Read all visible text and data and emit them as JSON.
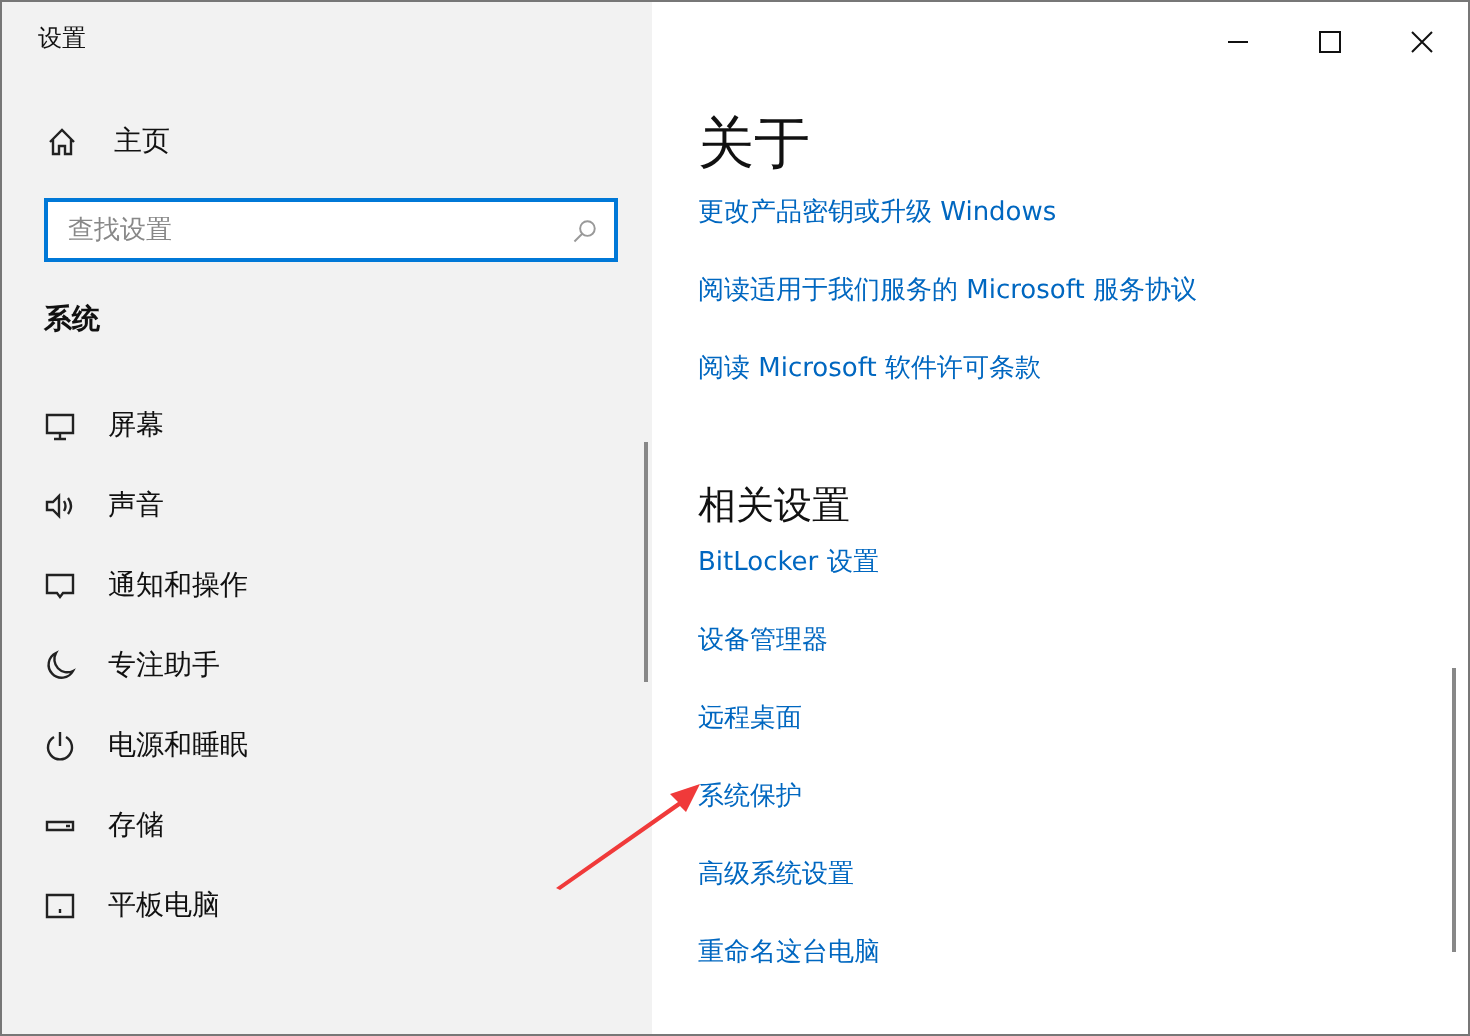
{
  "window": {
    "title": "设置"
  },
  "sidebar": {
    "home": "主页",
    "search": {
      "placeholder": "查找设置"
    },
    "section": "系统",
    "items": [
      {
        "label": "屏幕"
      },
      {
        "label": "声音"
      },
      {
        "label": "通知和操作"
      },
      {
        "label": "专注助手"
      },
      {
        "label": "电源和睡眠"
      },
      {
        "label": "存储"
      },
      {
        "label": "平板电脑"
      }
    ]
  },
  "content": {
    "title": "关于",
    "links": [
      "更改产品密钥或升级 Windows",
      "阅读适用于我们服务的 Microsoft 服务协议",
      "阅读 Microsoft 软件许可条款"
    ],
    "related_title": "相关设置",
    "related_links": [
      "BitLocker 设置",
      "设备管理器",
      "远程桌面",
      "系统保护",
      "高级系统设置",
      "重命名这台电脑"
    ]
  }
}
